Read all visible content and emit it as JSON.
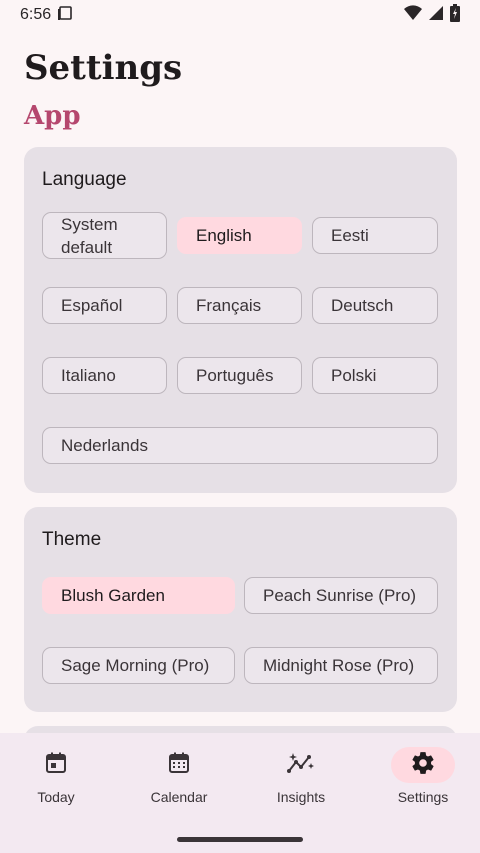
{
  "status": {
    "time": "6:56"
  },
  "header": {
    "title": "Settings",
    "section": "App"
  },
  "language": {
    "title": "Language",
    "options": [
      {
        "label": "System\ndefault"
      },
      {
        "label": "English"
      },
      {
        "label": "Eesti"
      },
      {
        "label": "Español"
      },
      {
        "label": "Français"
      },
      {
        "label": "Deutsch"
      },
      {
        "label": "Italiano"
      },
      {
        "label": "Português"
      },
      {
        "label": "Polski"
      },
      {
        "label": "Nederlands"
      }
    ],
    "selected": "English"
  },
  "theme": {
    "title": "Theme",
    "options": [
      {
        "label": "Blush Garden"
      },
      {
        "label": "Peach Sunrise (Pro)"
      },
      {
        "label": "Sage Morning (Pro)"
      },
      {
        "label": "Midnight Rose (Pro)"
      }
    ],
    "selected": "Blush Garden"
  },
  "nav": {
    "items": [
      {
        "label": "Today",
        "icon": "calendar-today-icon"
      },
      {
        "label": "Calendar",
        "icon": "calendar-month-icon"
      },
      {
        "label": "Insights",
        "icon": "insights-icon"
      },
      {
        "label": "Settings",
        "icon": "gear-icon"
      }
    ],
    "active": "Settings"
  },
  "colors": {
    "accent": "#b5476e",
    "selected_chip": "#ffd9e0",
    "card": "#e6e0e6",
    "background": "#fcf5f6"
  }
}
